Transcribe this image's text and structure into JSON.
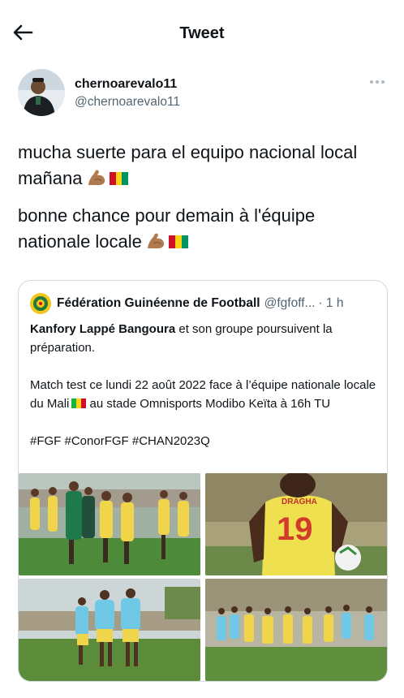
{
  "header": {
    "title": "Tweet",
    "back_icon": "arrow-left-icon"
  },
  "author": {
    "display_name": "chernoarevalo11",
    "handle": "@chernoarevalo11"
  },
  "tweet": {
    "line1": "mucha suerte para el equipo nacional local mañana",
    "line2": "bonne chance pour demain à l'équipe nationale locale"
  },
  "quoted_tweet": {
    "author_name": "Fédération Guinéenne de Football",
    "handle": "@fgfoff...",
    "time": "· 1 h",
    "text_bold": "Kanfory Lappé Bangoura",
    "text_rest": " et son groupe poursuivent la préparation.",
    "text_match_a": "Match test ce lundi 22 août 2022 face à l’équipe nationale locale du Mali",
    "text_match_b": " au stade Omnisports Modibo Keïta à 16h TU",
    "hashtags": "#FGF #ConorFGF #CHAN2023Q",
    "photo_count": 4
  },
  "colors": {
    "text": "#0f1419",
    "secondary": "#536471",
    "border": "#cfd9de",
    "guinea_flag": [
      "#ce1126",
      "#fcd116",
      "#009460"
    ],
    "mali_flag": [
      "#14b53a",
      "#fcd116",
      "#ce1126"
    ],
    "jersey_yellow": "#f0d44a",
    "training_bib": "#6fc8e6"
  }
}
